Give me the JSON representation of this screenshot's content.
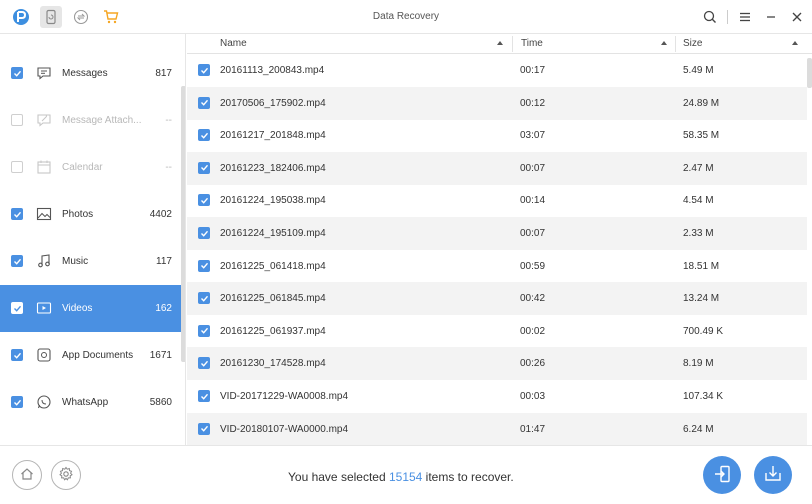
{
  "app": {
    "title": "Data Recovery"
  },
  "toolbar": {
    "icons": [
      "app-logo-icon",
      "phone-backup-icon",
      "transfer-icon",
      "cart-icon"
    ],
    "right_icons": [
      "search-icon",
      "menu-icon",
      "minimize-icon",
      "close-icon"
    ]
  },
  "sidebar": {
    "items": [
      {
        "label": "Messages",
        "count": "817",
        "icon": "messages-icon",
        "checked": true,
        "disabled": false
      },
      {
        "label": "Message Attach...",
        "count": "--",
        "icon": "attachment-icon",
        "checked": false,
        "disabled": true
      },
      {
        "label": "Calendar",
        "count": "--",
        "icon": "calendar-icon",
        "checked": false,
        "disabled": true
      },
      {
        "label": "Photos",
        "count": "4402",
        "icon": "photos-icon",
        "checked": true,
        "disabled": false
      },
      {
        "label": "Music",
        "count": "117",
        "icon": "music-icon",
        "checked": true,
        "disabled": false
      },
      {
        "label": "Videos",
        "count": "162",
        "icon": "videos-icon",
        "checked": true,
        "disabled": false,
        "selected": true
      },
      {
        "label": "App Documents",
        "count": "1671",
        "icon": "app-documents-icon",
        "checked": true,
        "disabled": false
      },
      {
        "label": "WhatsApp",
        "count": "5860",
        "icon": "whatsapp-icon",
        "checked": true,
        "disabled": false
      }
    ]
  },
  "table": {
    "columns": [
      "Name",
      "Time",
      "Size"
    ],
    "rows": [
      {
        "name": "20161113_200843.mp4",
        "time": "00:17",
        "size": "5.49 M"
      },
      {
        "name": "20170506_175902.mp4",
        "time": "00:12",
        "size": "24.89 M"
      },
      {
        "name": "20161217_201848.mp4",
        "time": "03:07",
        "size": "58.35 M"
      },
      {
        "name": "20161223_182406.mp4",
        "time": "00:07",
        "size": "2.47 M"
      },
      {
        "name": "20161224_195038.mp4",
        "time": "00:14",
        "size": "4.54 M"
      },
      {
        "name": "20161224_195109.mp4",
        "time": "00:07",
        "size": "2.33 M"
      },
      {
        "name": "20161225_061418.mp4",
        "time": "00:59",
        "size": "18.51 M"
      },
      {
        "name": "20161225_061845.mp4",
        "time": "00:42",
        "size": "13.24 M"
      },
      {
        "name": "20161225_061937.mp4",
        "time": "00:02",
        "size": "700.49 K"
      },
      {
        "name": "20161230_174528.mp4",
        "time": "00:26",
        "size": "8.19 M"
      },
      {
        "name": "VID-20171229-WA0008.mp4",
        "time": "00:03",
        "size": "107.34 K"
      },
      {
        "name": "VID-20180107-WA0000.mp4",
        "time": "01:47",
        "size": "6.24 M"
      }
    ]
  },
  "footer": {
    "status_prefix": "You have selected ",
    "status_count": "15154",
    "status_suffix": " items to recover."
  },
  "colors": {
    "accent": "#4a90e2",
    "logo": "#3d8fe0",
    "cart": "#f5a623"
  }
}
